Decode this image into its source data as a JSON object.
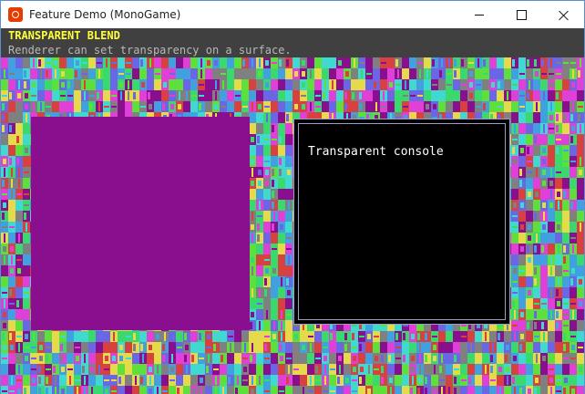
{
  "window": {
    "title": "Feature Demo (MonoGame)",
    "icon": "monogame-app-icon",
    "controls": [
      "minimize-icon",
      "maximize-icon",
      "close-icon"
    ]
  },
  "demo": {
    "title": "TRANSPARENT BLEND",
    "subtitle": "Renderer can set transparency on a surface."
  },
  "console": {
    "text": "Transparent console"
  },
  "colors": {
    "title_text": "#ffff3a",
    "subtitle_text": "#b8b8b8",
    "header_band": "#404040",
    "surface_purple": "#8a0f8f",
    "console_border": "#9c9cc8",
    "background_palette": [
      "#e03fd8",
      "#3fd9d0",
      "#5ee03a",
      "#6a66e6",
      "#e6d94a",
      "#8a0f8f",
      "#3ad96e",
      "#d94040",
      "#808080",
      "#40a0e0"
    ]
  }
}
